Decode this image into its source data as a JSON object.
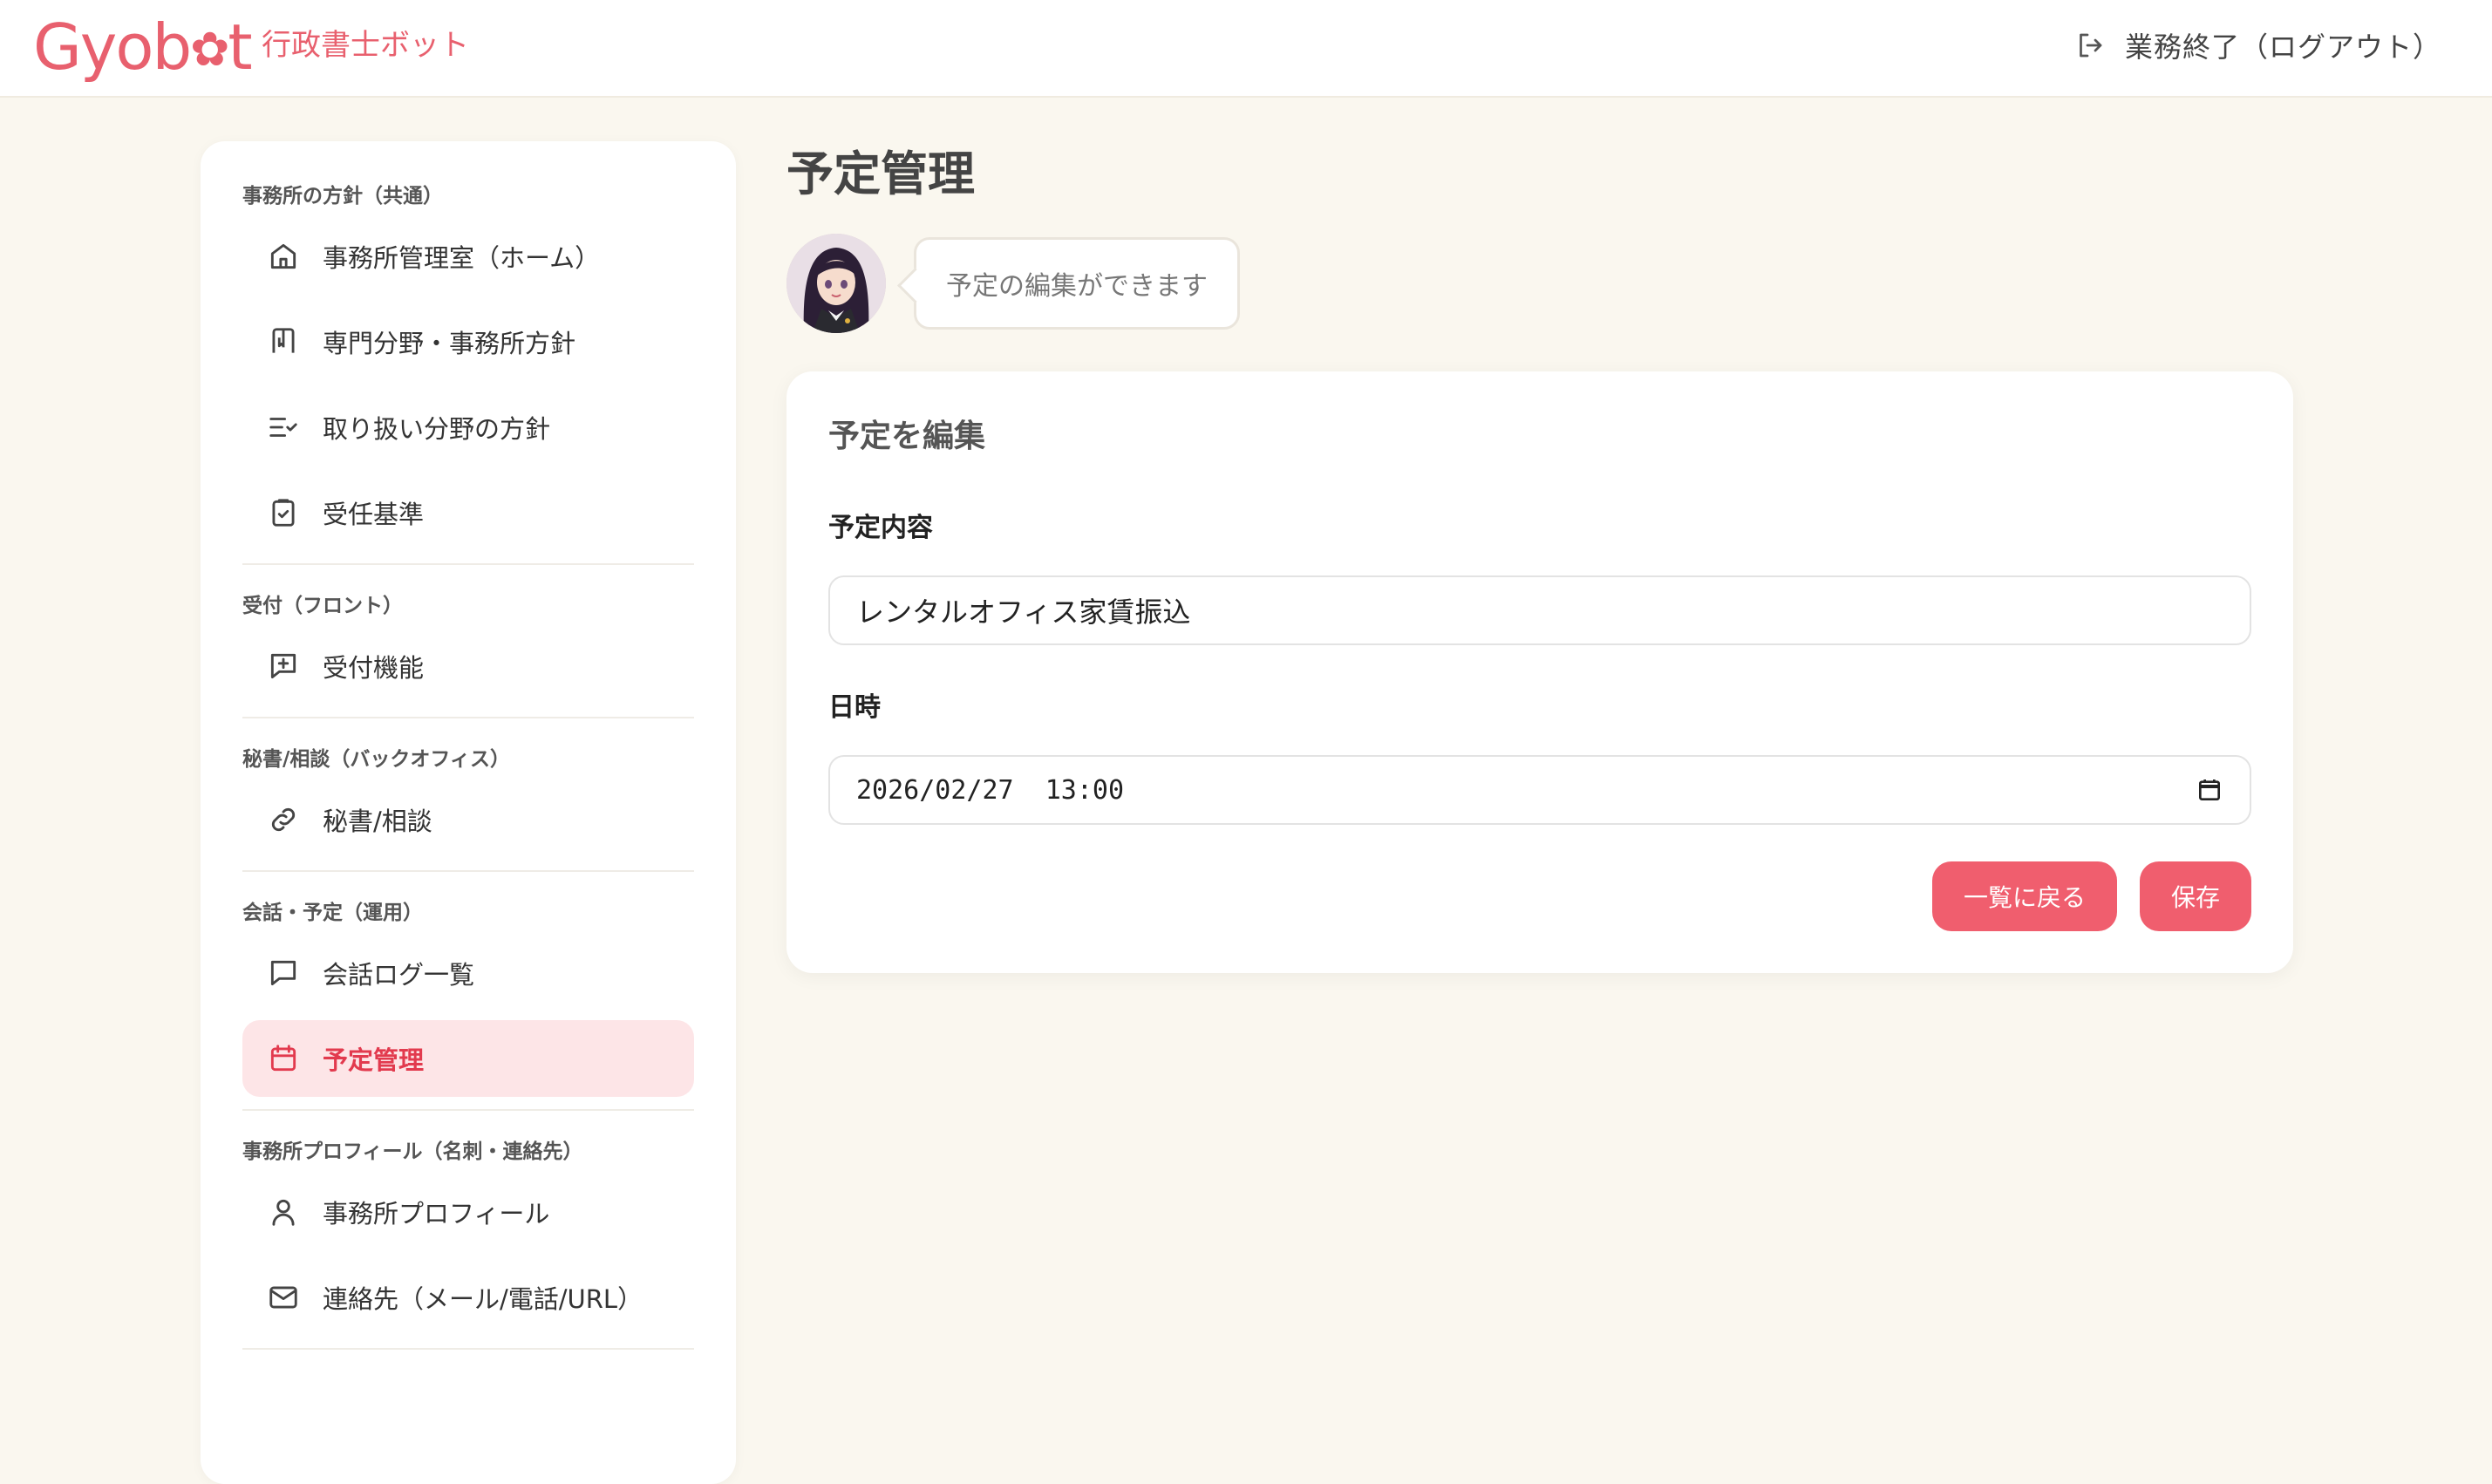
{
  "header": {
    "logo_text": "Gyob",
    "logo_gear": "✿",
    "logo_end": "t",
    "tagline": "行政書士ボット",
    "logout_label": "業務終了（ログアウト）"
  },
  "sidebar": {
    "sections": [
      {
        "title": "事務所の方針（共通）",
        "items": [
          {
            "label": "事務所管理室（ホーム）",
            "icon": "home-icon"
          },
          {
            "label": "専門分野・事務所方針",
            "icon": "bookmark-book-icon"
          },
          {
            "label": "取り扱い分野の方針",
            "icon": "checklist-icon"
          },
          {
            "label": "受任基準",
            "icon": "clipboard-check-icon"
          }
        ]
      },
      {
        "title": "受付（フロント）",
        "items": [
          {
            "label": "受付機能",
            "icon": "message-plus-icon"
          }
        ]
      },
      {
        "title": "秘書/相談（バックオフィス）",
        "items": [
          {
            "label": "秘書/相談",
            "icon": "link-icon"
          }
        ]
      },
      {
        "title": "会話・予定（運用）",
        "items": [
          {
            "label": "会話ログ一覧",
            "icon": "chat-bubble-icon"
          },
          {
            "label": "予定管理",
            "icon": "calendar-icon",
            "active": true
          }
        ]
      },
      {
        "title": "事務所プロフィール（名刺・連絡先）",
        "items": [
          {
            "label": "事務所プロフィール",
            "icon": "user-icon"
          },
          {
            "label": "連絡先（メール/電話/URL）",
            "icon": "mail-icon"
          }
        ]
      }
    ]
  },
  "main": {
    "page_title": "予定管理",
    "assistant_message": "予定の編集ができます",
    "card": {
      "title": "予定を編集",
      "content_label": "予定内容",
      "content_value": "レンタルオフィス家賃振込",
      "datetime_label": "日時",
      "datetime_value": "2026/02/27  13:00",
      "back_button": "一覧に戻る",
      "save_button": "保存"
    }
  },
  "colors": {
    "accent": "#f05e6e",
    "brand": "#e8606e",
    "active_bg": "#fde5e7",
    "page_bg": "#faf7ef"
  }
}
